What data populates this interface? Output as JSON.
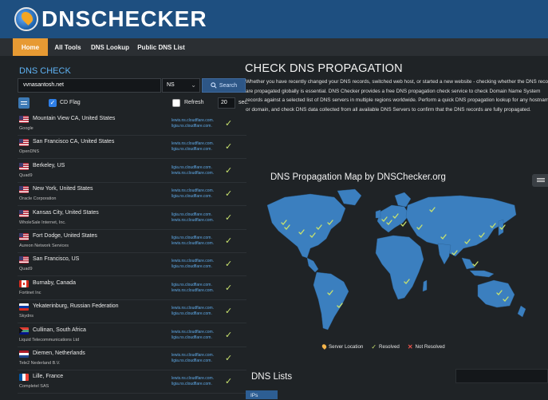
{
  "header": {
    "logo_text": "DNSCHECKER"
  },
  "nav": {
    "items": [
      {
        "label": "Home",
        "active": true
      },
      {
        "label": "All Tools",
        "active": false
      },
      {
        "label": "DNS Lookup",
        "active": false
      },
      {
        "label": "Public DNS List",
        "active": false
      }
    ]
  },
  "dns_check": {
    "title": "DNS CHECK",
    "domain_value": "vvnasantosh.net",
    "record_type": "NS",
    "search_label": "Search",
    "cd_flag_label": "CD Flag",
    "cd_flag_checked": true,
    "refresh_label": "Refresh",
    "refresh_value": "20",
    "refresh_unit": "sec."
  },
  "servers": [
    {
      "location": "Mountain View CA, United States",
      "provider": "Google",
      "flag": "us",
      "result": [
        "lewis.ns.cloudflare.com.",
        "ligia.ns.cloudflare.com."
      ]
    },
    {
      "location": "San Francisco CA, United States",
      "provider": "OpenDNS",
      "flag": "us",
      "result": [
        "lewis.ns.cloudflare.com.",
        "ligia.ns.cloudflare.com."
      ]
    },
    {
      "location": "Berkeley, US",
      "provider": "Quad9",
      "flag": "us",
      "result": [
        "ligia.ns.cloudflare.com.",
        "lewis.ns.cloudflare.com."
      ]
    },
    {
      "location": "New York, United States",
      "provider": "Oracle Corporation",
      "flag": "us",
      "result": [
        "lewis.ns.cloudflare.com.",
        "ligia.ns.cloudflare.com."
      ]
    },
    {
      "location": "Kansas City, United States",
      "provider": "WholeSale Internet, Inc.",
      "flag": "us",
      "result": [
        "ligia.ns.cloudflare.com.",
        "lewis.ns.cloudflare.com."
      ]
    },
    {
      "location": "Fort Dodge, United States",
      "provider": "Aureon Network Services",
      "flag": "us",
      "result": [
        "ligia.ns.cloudflare.com.",
        "lewis.ns.cloudflare.com."
      ]
    },
    {
      "location": "San Francisco, US",
      "provider": "Quad9",
      "flag": "us",
      "result": [
        "lewis.ns.cloudflare.com.",
        "ligia.ns.cloudflare.com."
      ]
    },
    {
      "location": "Burnaby, Canada",
      "provider": "Fortinet Inc",
      "flag": "ca",
      "result": [
        "ligia.ns.cloudflare.com.",
        "lewis.ns.cloudflare.com."
      ]
    },
    {
      "location": "Yekaterinburg, Russian Federation",
      "provider": "Skydns",
      "flag": "ru",
      "result": [
        "lewis.ns.cloudflare.com.",
        "ligia.ns.cloudflare.com."
      ]
    },
    {
      "location": "Cullinan, South Africa",
      "provider": "Liquid Telecommunications Ltd",
      "flag": "za",
      "result": [
        "lewis.ns.cloudflare.com.",
        "ligia.ns.cloudflare.com."
      ]
    },
    {
      "location": "Diemen, Netherlands",
      "provider": "Tele2 Nederland B.V.",
      "flag": "nl",
      "result": [
        "lewis.ns.cloudflare.com.",
        "ligia.ns.cloudflare.com."
      ]
    },
    {
      "location": "Lille, France",
      "provider": "Completel SAS",
      "flag": "fr",
      "result": [
        "lewis.ns.cloudflare.com.",
        "ligia.ns.cloudflare.com."
      ]
    }
  ],
  "main": {
    "title": "CHECK DNS PROPAGATION",
    "description": "Whether you have recently changed your DNS records, switched web host, or started a new website - checking whether the DNS records are propagated globally is essential. DNS Checker provides a free DNS propagation check service to check Domain Name System records against a selected list of DNS servers in multiple regions worldwide. Perform a quick DNS propagation lookup for any hostname or domain, and check DNS data collected from all available DNS Servers to confirm that the DNS records are fully propagated.",
    "map_title": "DNS Propagation Map by DNSChecker.org",
    "legend": {
      "server_location": "Server Location",
      "resolved": "Resolved",
      "not_resolved": "Not Resolved"
    },
    "dns_lists_title": "DNS Lists",
    "ips_tab": "IPs"
  },
  "colors": {
    "header_bg": "#1e4f80",
    "accent": "#e79a33",
    "link": "#5ea8e6",
    "tick": "#c8e26e",
    "map_land": "#3b7fbf",
    "not_resolved": "#e8524a"
  }
}
